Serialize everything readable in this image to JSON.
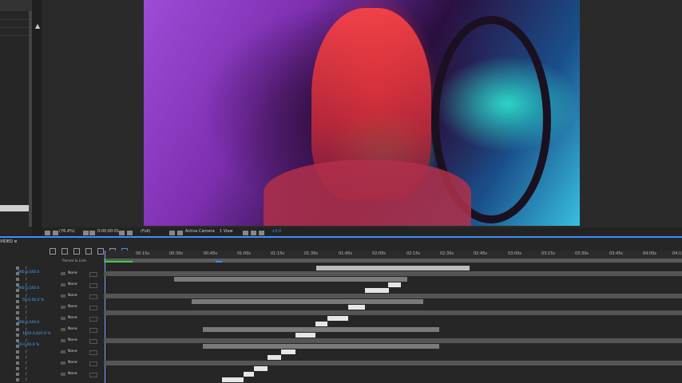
{
  "left_panel": {
    "label": ""
  },
  "viewer": {
    "toolbar": {
      "zoom": "(76.4%)",
      "timecode": "0:00:00:01",
      "resolution": "(Full)",
      "camera": "Active Camera",
      "views": "1 View",
      "exposure": "+0.0"
    }
  },
  "timeline": {
    "tab": "VIDEO",
    "column_header": "Parent & Link",
    "ruler_ticks": [
      "00:15s",
      "00:30s",
      "00:45s",
      "01:00s",
      "01:15s",
      "01:30s",
      "01:45s",
      "02:00s",
      "02:15s",
      "02:30s",
      "02:45s",
      "03:00s",
      "03:15s",
      "03:30s",
      "03:45s",
      "04:00s",
      "04:15"
    ],
    "values": [
      "960.0,540.0",
      "960.0,540.0",
      "50.0,50.0 %",
      "960.0,540.0",
      "1850.0,820.0 %",
      "50.0,50.0 %"
    ],
    "parent_values": [
      "None",
      "None",
      "None",
      "None",
      "None",
      "None",
      "None",
      "None",
      "None",
      "None",
      "None",
      "None",
      "None",
      "None",
      "None",
      "None",
      "None",
      "None"
    ],
    "colors": {
      "accent": "#3a8fff",
      "work_area": "#40d040"
    }
  }
}
